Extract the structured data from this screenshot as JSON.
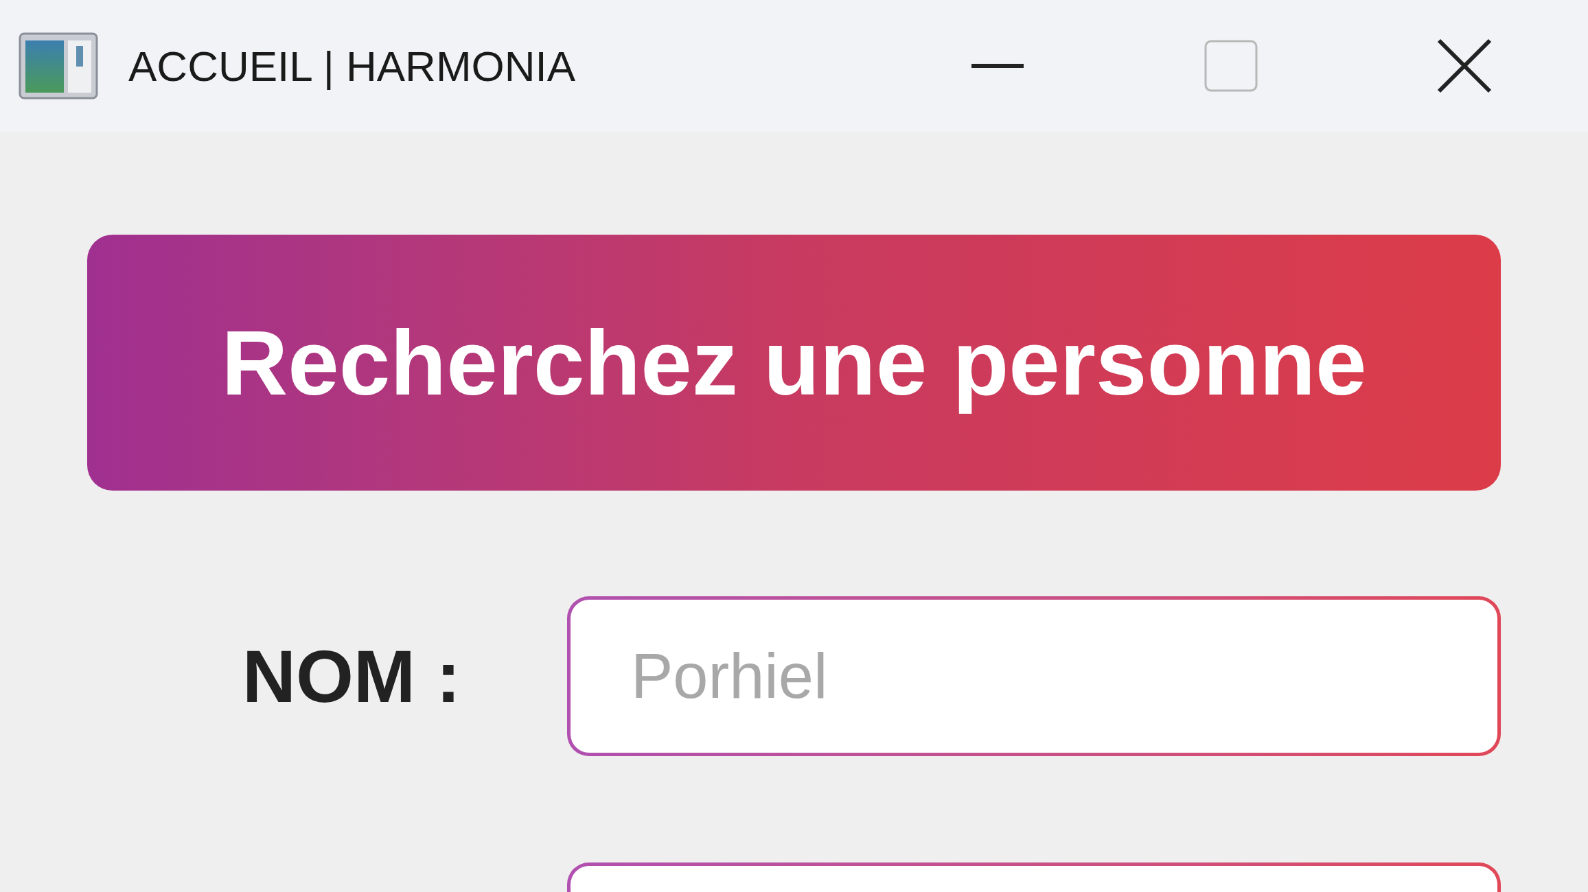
{
  "window": {
    "title": "ACCUEIL | HARMONIA"
  },
  "banner": {
    "title": "Recherchez une personne"
  },
  "fields": [
    {
      "kind": "text",
      "label": "NOM :",
      "placeholder": "Porhiel"
    },
    {
      "kind": "cut"
    }
  ]
}
